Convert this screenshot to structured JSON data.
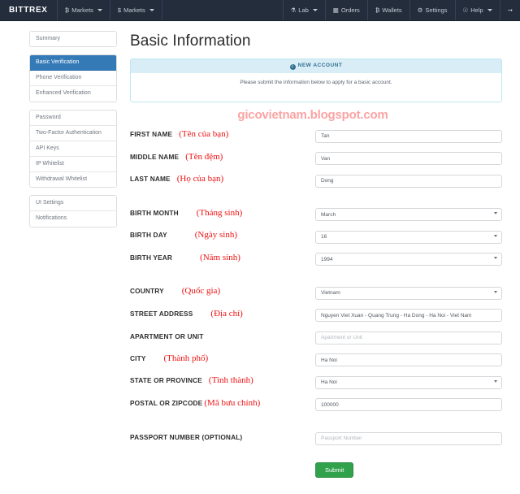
{
  "navbar": {
    "brand": "BITTREX",
    "left_items": [
      {
        "icon": "bitcoin-icon",
        "glyph": "₿",
        "label": "Markets",
        "caret": true
      },
      {
        "icon": "dollar-icon",
        "glyph": "$",
        "label": "Markets",
        "caret": true
      }
    ],
    "right_items": [
      {
        "icon": "lab-flask-icon",
        "glyph": "⚗",
        "label": "Lab",
        "caret": true
      },
      {
        "icon": "clipboard-icon",
        "glyph": "ὌB",
        "label": "Orders",
        "caret": false
      },
      {
        "icon": "wallet-icon",
        "glyph": "₿",
        "label": "Wallets",
        "caret": false
      },
      {
        "icon": "gear-icon",
        "glyph": "⚙",
        "label": "Settings",
        "caret": false
      },
      {
        "icon": "help-circle-icon",
        "glyph": "⊙",
        "label": "Help",
        "caret": true
      },
      {
        "icon": "logout-icon",
        "glyph": "→",
        "label": "",
        "caret": false
      }
    ]
  },
  "sidebar": {
    "groups": [
      {
        "items": [
          {
            "label": "Summary",
            "active": false
          }
        ]
      },
      {
        "items": [
          {
            "label": "Basic Verification",
            "active": true
          },
          {
            "label": "Phone Verification",
            "active": false
          },
          {
            "label": "Enhanced Verification",
            "active": false
          }
        ]
      },
      {
        "items": [
          {
            "label": "Password",
            "active": false
          },
          {
            "label": "Two-Factor Authentication",
            "active": false
          },
          {
            "label": "API Keys",
            "active": false
          },
          {
            "label": "IP Whitelist",
            "active": false
          },
          {
            "label": "Withdrawal Whitelist",
            "active": false
          }
        ]
      },
      {
        "items": [
          {
            "label": "UI Settings",
            "active": false
          },
          {
            "label": "Notifications",
            "active": false
          }
        ]
      }
    ]
  },
  "main": {
    "title": "Basic Information",
    "alert": {
      "heading": "NEW ACCOUNT",
      "body": "Please submit the information below to apply for a basic account."
    },
    "watermark": "gicovietnam.blogspot.com",
    "submit_label": "Submit"
  },
  "form": {
    "first_name": {
      "label": "FIRST NAME",
      "vi": "(Tên của bạn)",
      "value": "Tan",
      "placeholder": "First Name",
      "type": "text"
    },
    "middle_name": {
      "label": "MIDDLE NAME",
      "vi": "(Tên đệm)",
      "value": "Van",
      "placeholder": "Middle Name",
      "type": "text"
    },
    "last_name": {
      "label": "LAST NAME",
      "vi": "(Họ của bạn)",
      "value": "Dong",
      "placeholder": "Last Name",
      "type": "text"
    },
    "birth_month": {
      "label": "BIRTH MONTH",
      "vi": "(Tháng sinh)",
      "value": "March",
      "type": "select"
    },
    "birth_day": {
      "label": "BIRTH DAY",
      "vi": "(Ngày sinh)",
      "value": "16",
      "type": "select"
    },
    "birth_year": {
      "label": "BIRTH YEAR",
      "vi": "(Năm sinh)",
      "value": "1994",
      "type": "select"
    },
    "country": {
      "label": "COUNTRY",
      "vi": "(Quốc gia)",
      "value": "Vietnam",
      "type": "select"
    },
    "street": {
      "label": "STREET ADDRESS",
      "vi": "(Địa chỉ)",
      "value": "Nguyen Viet Xuan - Quang Trung - Ha Dong - Ha Noi - Viet Nam",
      "placeholder": "Street Address",
      "type": "text"
    },
    "apartment": {
      "label": "APARTMENT OR UNIT",
      "vi": "",
      "value": "",
      "placeholder": "Apartment or Unit",
      "type": "text"
    },
    "city": {
      "label": "CITY",
      "vi": "(Thành phố)",
      "value": "Ha Noi",
      "placeholder": "City",
      "type": "text"
    },
    "state": {
      "label": "STATE OR PROVINCE",
      "vi": "(Tinh thành)",
      "value": "Ha Noi",
      "type": "select"
    },
    "postal": {
      "label": "POSTAL OR ZIPCODE",
      "vi": "(Mã bưu chính)",
      "value": "100000",
      "placeholder": "Postal or Zipcode",
      "type": "text"
    },
    "passport": {
      "label": "PASSPORT NUMBER (OPTIONAL)",
      "vi": "",
      "value": "",
      "placeholder": "Passport Number",
      "type": "text"
    }
  }
}
